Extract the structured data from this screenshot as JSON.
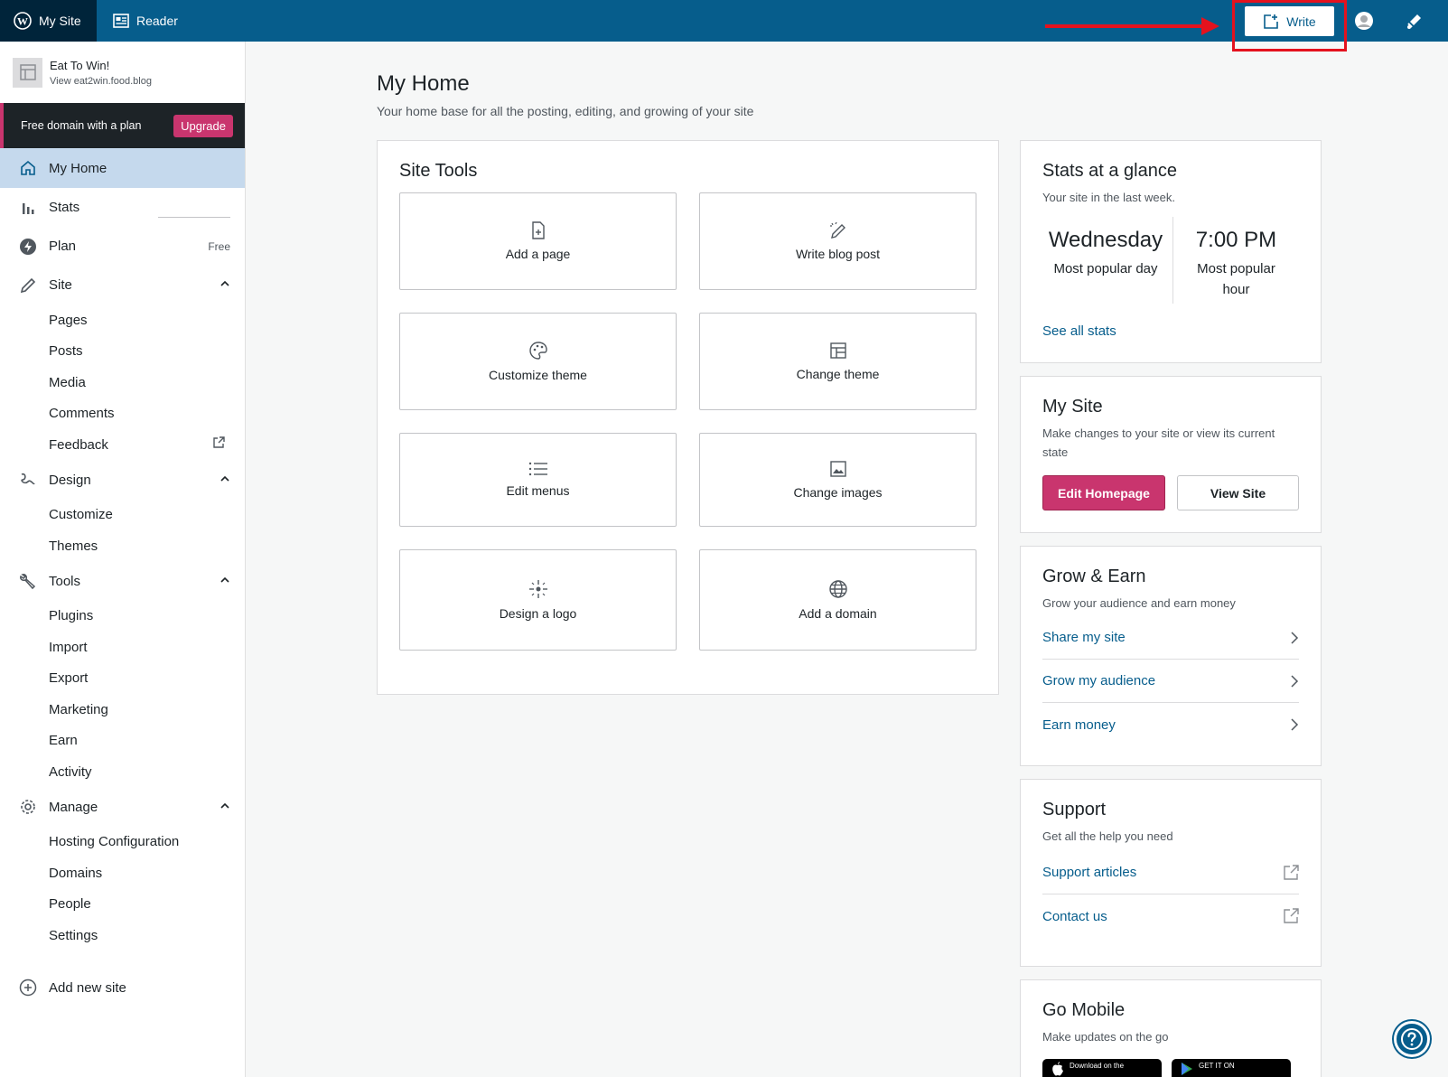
{
  "masterbar": {
    "my_site": "My Site",
    "reader": "Reader",
    "write": "Write"
  },
  "sidebar": {
    "site_name": "Eat To Win!",
    "site_url": "View eat2win.food.blog",
    "promo_text": "Free domain with a plan",
    "upgrade": "Upgrade",
    "items": {
      "my_home": "My Home",
      "stats": "Stats",
      "plan": "Plan",
      "plan_badge": "Free",
      "site": "Site",
      "pages": "Pages",
      "posts": "Posts",
      "media": "Media",
      "comments": "Comments",
      "feedback": "Feedback",
      "design": "Design",
      "customize": "Customize",
      "themes": "Themes",
      "tools": "Tools",
      "plugins": "Plugins",
      "import": "Import",
      "export": "Export",
      "marketing": "Marketing",
      "earn": "Earn",
      "activity": "Activity",
      "manage": "Manage",
      "hosting_configuration": "Hosting Configuration",
      "domains": "Domains",
      "people": "People",
      "settings": "Settings",
      "add_new_site": "Add new site"
    }
  },
  "main": {
    "title": "My Home",
    "subtitle": "Your home base for all the posting, editing, and growing of your site"
  },
  "site_tools": {
    "title": "Site Tools",
    "tools": [
      {
        "label": "Add a page",
        "icon": "add-page-icon"
      },
      {
        "label": "Write blog post",
        "icon": "write-post-icon"
      },
      {
        "label": "Customize theme",
        "icon": "palette-icon"
      },
      {
        "label": "Change theme",
        "icon": "layout-icon"
      },
      {
        "label": "Edit menus",
        "icon": "menu-list-icon"
      },
      {
        "label": "Change images",
        "icon": "image-icon"
      },
      {
        "label": "Design a logo",
        "icon": "sparkle-icon"
      },
      {
        "label": "Add a domain",
        "icon": "globe-icon"
      }
    ]
  },
  "stats": {
    "title": "Stats at a glance",
    "subtitle": "Your site in the last week.",
    "day_value": "Wednesday",
    "day_label": "Most popular day",
    "hour_value": "7:00 PM",
    "hour_label_1": "Most popular",
    "hour_label_2": "hour",
    "see_all": "See all stats"
  },
  "my_site_card": {
    "title": "My Site",
    "subtitle": "Make changes to your site or view its current state",
    "edit_homepage": "Edit Homepage",
    "view_site": "View Site"
  },
  "grow": {
    "title": "Grow & Earn",
    "subtitle": "Grow your audience and earn money",
    "links": [
      "Share my site",
      "Grow my audience",
      "Earn money"
    ]
  },
  "support": {
    "title": "Support",
    "subtitle": "Get all the help you need",
    "links": [
      "Support articles",
      "Contact us"
    ]
  },
  "mobile": {
    "title": "Go Mobile",
    "subtitle": "Make updates on the go",
    "app_store": "Download on the",
    "google_play": "GET IT ON"
  },
  "colors": {
    "masterbar": "#065d8c",
    "accent_pink": "#c9356e",
    "link_blue": "#065d8c",
    "annotation_red": "#e4121e"
  }
}
